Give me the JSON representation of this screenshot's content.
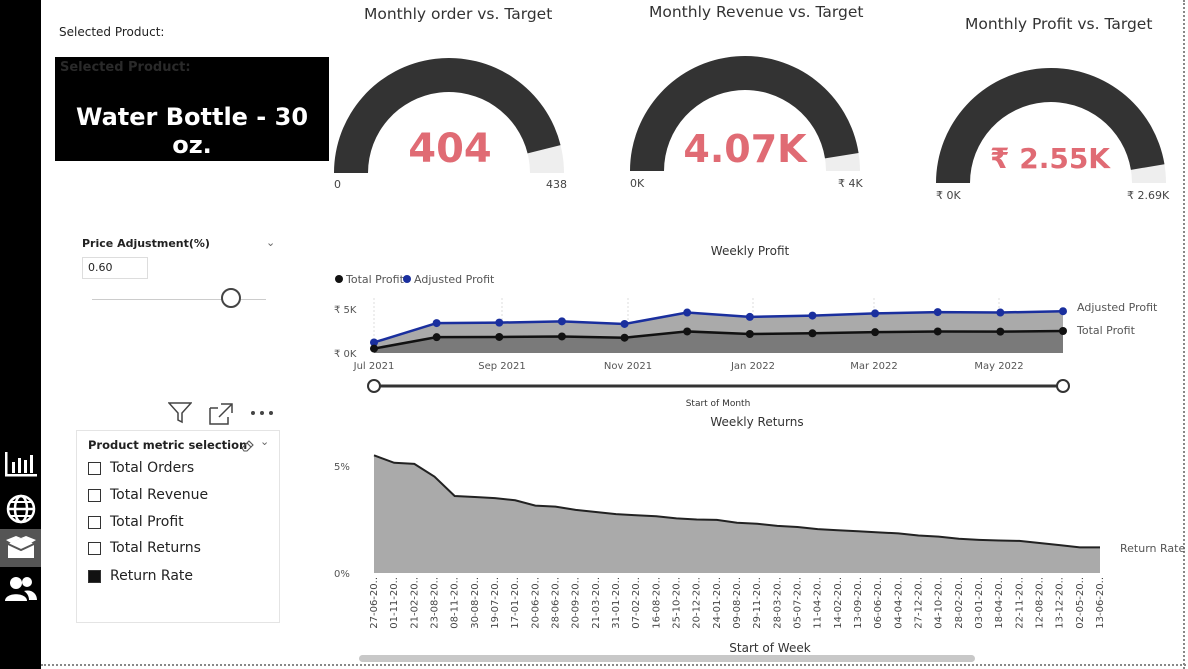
{
  "selected_product": {
    "label": "Selected Product:",
    "card_ghost_label": "Selected Product:",
    "value": "Water Bottle - 30 oz."
  },
  "gauges": [
    {
      "title": "Monthly order vs. Target",
      "value": "404",
      "min": "0",
      "max": "438",
      "fill_fraction": 0.922
    },
    {
      "title": "Monthly Revenue vs. Target",
      "value": "4.07K",
      "min": "0K",
      "max": "₹ 4K",
      "fill_fraction": 0.95
    },
    {
      "title": "Monthly Profit vs. Target",
      "value": "₹ 2.55K",
      "min": "₹ 0K",
      "max": "₹ 2.69K",
      "fill_fraction": 0.948
    }
  ],
  "price_adjustment": {
    "title": "Price Adjustment(%)",
    "value": "0.60",
    "slider_fraction": 0.8
  },
  "toolbar": {
    "filter_icon": "filter-icon",
    "focus_icon": "focus-mode-icon",
    "more_icon": "more-options-icon"
  },
  "metric_selection": {
    "title": "Product metric selection",
    "items": [
      {
        "label": "Total Orders",
        "checked": false
      },
      {
        "label": "Total Revenue",
        "checked": false
      },
      {
        "label": "Total Profit",
        "checked": false
      },
      {
        "label": "Total Returns",
        "checked": false
      },
      {
        "label": "Return Rate",
        "checked": true
      }
    ]
  },
  "nav": {
    "items": [
      "report-chart-icon",
      "globe-icon",
      "product-box-icon",
      "customers-icon"
    ],
    "active_index": 2
  },
  "colors": {
    "gauge_fill": "#333333",
    "gauge_track": "#eeeeee",
    "kpi_value": "#e06b74",
    "adjusted_profit": "#1a2f9e",
    "total_profit": "#111111",
    "area_fill": "#aaaaaa",
    "area_dark": "#7a7a7a"
  },
  "chart_data": [
    {
      "type": "line",
      "title": "Weekly Profit",
      "legend": [
        "Total Profit",
        "Adjusted Profit"
      ],
      "legend_position": "top-left",
      "xlabel": "Start of Month",
      "ylabel": "",
      "x_ticks": [
        "Jul 2021",
        "Sep 2021",
        "Nov 2021",
        "Jan 2022",
        "Mar 2022",
        "May 2022"
      ],
      "y_ticks": [
        "₹ 0K",
        "₹ 5K"
      ],
      "ylim": [
        0,
        5000
      ],
      "x": [
        0,
        1,
        2,
        3,
        4,
        5,
        6,
        7,
        8,
        9,
        10,
        11
      ],
      "series": [
        {
          "name": "Adjusted Profit",
          "values": [
            1200,
            3400,
            3450,
            3600,
            3300,
            4600,
            4100,
            4250,
            4500,
            4650,
            4600,
            4750
          ]
        },
        {
          "name": "Total Profit",
          "values": [
            500,
            1800,
            1820,
            1880,
            1740,
            2450,
            2160,
            2240,
            2370,
            2450,
            2430,
            2500
          ]
        }
      ],
      "end_labels": [
        "Adjusted Profit",
        "Total Profit"
      ],
      "range_slider": [
        0,
        1
      ]
    },
    {
      "type": "area",
      "title": "Weekly Returns",
      "xlabel": "Start of Week",
      "ylabel": "",
      "y_ticks": [
        "0%",
        "5%"
      ],
      "ylim": [
        0,
        5
      ],
      "series_label": "Return Rate",
      "categories": [
        "27-06-20..",
        "01-11-20..",
        "21-02-20..",
        "23-08-20..",
        "08-11-20..",
        "30-08-20..",
        "19-07-20..",
        "17-01-20..",
        "20-06-20..",
        "28-06-20..",
        "20-09-20..",
        "21-03-20..",
        "31-01-20..",
        "07-02-20..",
        "16-08-20..",
        "25-10-20..",
        "20-12-20..",
        "24-01-20..",
        "09-08-20..",
        "29-11-20..",
        "28-03-20..",
        "05-07-20..",
        "11-04-20..",
        "14-02-20..",
        "13-09-20..",
        "06-06-20..",
        "04-04-20..",
        "27-12-20..",
        "04-10-20..",
        "28-02-20..",
        "03-01-20..",
        "18-04-20..",
        "22-11-20..",
        "12-08-20..",
        "13-12-20..",
        "02-05-20..",
        "13-06-20.."
      ],
      "values": [
        5.5,
        5.15,
        5.1,
        4.5,
        3.6,
        3.55,
        3.5,
        3.4,
        3.15,
        3.1,
        2.95,
        2.85,
        2.75,
        2.7,
        2.65,
        2.55,
        2.5,
        2.48,
        2.35,
        2.3,
        2.2,
        2.15,
        2.05,
        2.0,
        1.95,
        1.9,
        1.85,
        1.75,
        1.7,
        1.6,
        1.55,
        1.52,
        1.5,
        1.4,
        1.3,
        1.2,
        1.2
      ]
    }
  ]
}
